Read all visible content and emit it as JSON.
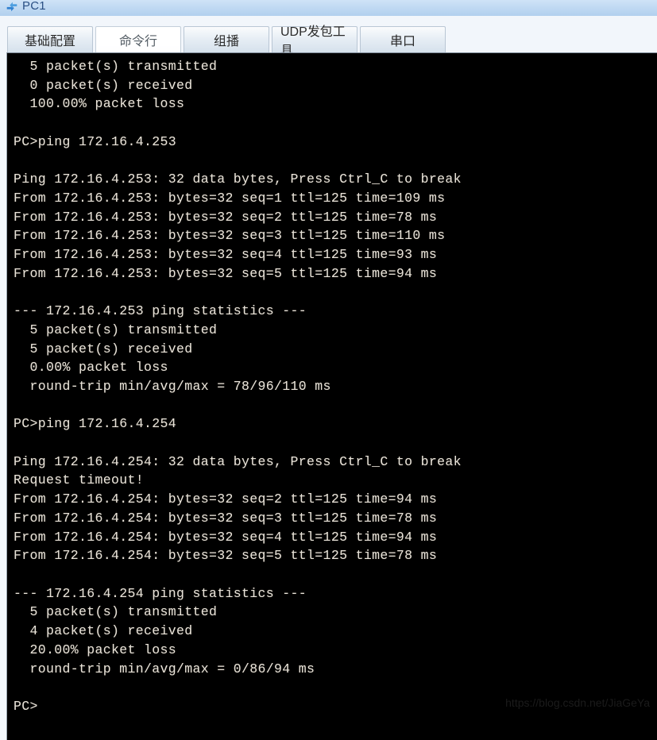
{
  "window": {
    "title": "PC1",
    "icon": "network-device-icon",
    "title_color": "#2a4f84"
  },
  "tabs": [
    {
      "label": "基础配置",
      "active": false,
      "name": "tab-basic-config"
    },
    {
      "label": "命令行",
      "active": true,
      "name": "tab-command-line"
    },
    {
      "label": "组播",
      "active": false,
      "name": "tab-multicast"
    },
    {
      "label": "UDP发包工具",
      "active": false,
      "name": "tab-udp-tool"
    },
    {
      "label": "串口",
      "active": false,
      "name": "tab-serial-port"
    }
  ],
  "console": {
    "background": "#000000",
    "foreground": "#e8e3da",
    "lines": [
      "  5 packet(s) transmitted",
      "  0 packet(s) received",
      "  100.00% packet loss",
      "",
      "PC>ping 172.16.4.253",
      "",
      "Ping 172.16.4.253: 32 data bytes, Press Ctrl_C to break",
      "From 172.16.4.253: bytes=32 seq=1 ttl=125 time=109 ms",
      "From 172.16.4.253: bytes=32 seq=2 ttl=125 time=78 ms",
      "From 172.16.4.253: bytes=32 seq=3 ttl=125 time=110 ms",
      "From 172.16.4.253: bytes=32 seq=4 ttl=125 time=93 ms",
      "From 172.16.4.253: bytes=32 seq=5 ttl=125 time=94 ms",
      "",
      "--- 172.16.4.253 ping statistics ---",
      "  5 packet(s) transmitted",
      "  5 packet(s) received",
      "  0.00% packet loss",
      "  round-trip min/avg/max = 78/96/110 ms",
      "",
      "PC>ping 172.16.4.254",
      "",
      "Ping 172.16.4.254: 32 data bytes, Press Ctrl_C to break",
      "Request timeout!",
      "From 172.16.4.254: bytes=32 seq=2 ttl=125 time=94 ms",
      "From 172.16.4.254: bytes=32 seq=3 ttl=125 time=78 ms",
      "From 172.16.4.254: bytes=32 seq=4 ttl=125 time=94 ms",
      "From 172.16.4.254: bytes=32 seq=5 ttl=125 time=78 ms",
      "",
      "--- 172.16.4.254 ping statistics ---",
      "  5 packet(s) transmitted",
      "  4 packet(s) received",
      "  20.00% packet loss",
      "  round-trip min/avg/max = 0/86/94 ms",
      "",
      "PC>"
    ],
    "text": "  5 packet(s) transmitted\n  0 packet(s) received\n  100.00% packet loss\n\nPC>ping 172.16.4.253\n\nPing 172.16.4.253: 32 data bytes, Press Ctrl_C to break\nFrom 172.16.4.253: bytes=32 seq=1 ttl=125 time=109 ms\nFrom 172.16.4.253: bytes=32 seq=2 ttl=125 time=78 ms\nFrom 172.16.4.253: bytes=32 seq=3 ttl=125 time=110 ms\nFrom 172.16.4.253: bytes=32 seq=4 ttl=125 time=93 ms\nFrom 172.16.4.253: bytes=32 seq=5 ttl=125 time=94 ms\n\n--- 172.16.4.253 ping statistics ---\n  5 packet(s) transmitted\n  5 packet(s) received\n  0.00% packet loss\n  round-trip min/avg/max = 78/96/110 ms\n\nPC>ping 172.16.4.254\n\nPing 172.16.4.254: 32 data bytes, Press Ctrl_C to break\nRequest timeout!\nFrom 172.16.4.254: bytes=32 seq=2 ttl=125 time=94 ms\nFrom 172.16.4.254: bytes=32 seq=3 ttl=125 time=78 ms\nFrom 172.16.4.254: bytes=32 seq=4 ttl=125 time=94 ms\nFrom 172.16.4.254: bytes=32 seq=5 ttl=125 time=78 ms\n\n--- 172.16.4.254 ping statistics ---\n  5 packet(s) transmitted\n  4 packet(s) received\n  20.00% packet loss\n  round-trip min/avg/max = 0/86/94 ms\n\nPC>",
    "prompt": "PC>"
  },
  "watermark": {
    "text": "https://blog.csdn.net/JiaGeYa"
  }
}
